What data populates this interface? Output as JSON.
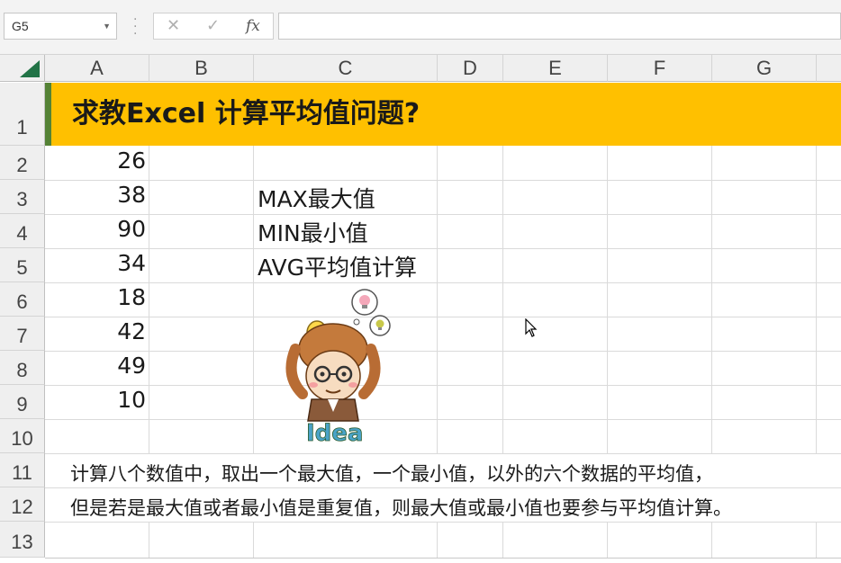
{
  "formula_bar": {
    "name_box": "G5",
    "cancel_icon": "✕",
    "enter_icon": "✓",
    "fx_label": "fx",
    "formula": ""
  },
  "columns": [
    "A",
    "B",
    "C",
    "D",
    "E",
    "F",
    "G"
  ],
  "rows": [
    "1",
    "2",
    "3",
    "4",
    "5",
    "6",
    "7",
    "8",
    "9",
    "10",
    "11",
    "12",
    "13"
  ],
  "sheet": {
    "title": "求教Excel 计算平均值问题?",
    "values": [
      "26",
      "38",
      "90",
      "34",
      "18",
      "42",
      "49",
      "10"
    ],
    "labels": [
      "MAX最大值",
      "MIN最小值",
      "AVG平均值计算"
    ],
    "note_line1": "计算八个数值中，取出一个最大值，一个最小值，以外的六个数据的平均值，",
    "note_line2": "但是若是最大值或者最小值是重复值，则最大值或最小值也要参与平均值计算。"
  },
  "colors": {
    "title_band": "#ffc000",
    "title_accent": "#548235",
    "grid": "#dadada",
    "header_bg": "#efefef"
  },
  "illustration": {
    "icon": "idea-character-illustration",
    "word": "Idea"
  }
}
